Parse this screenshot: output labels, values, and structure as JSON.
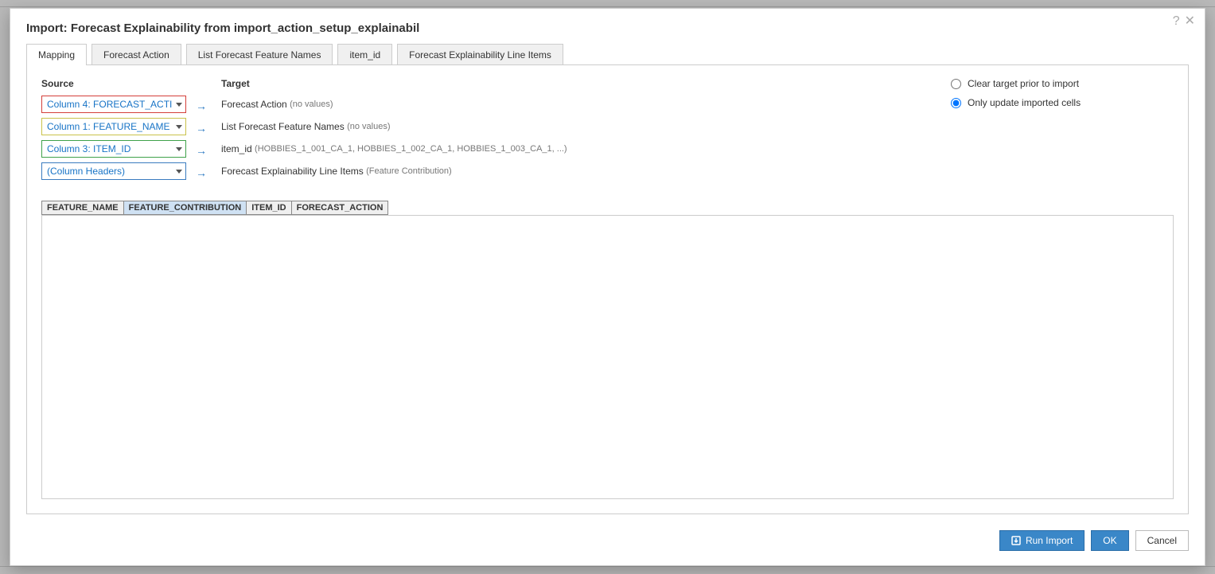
{
  "dialog": {
    "title": "Import: Forecast Explainability from import_action_setup_explainabil"
  },
  "tabs": [
    {
      "label": "Mapping",
      "active": true
    },
    {
      "label": "Forecast Action",
      "active": false
    },
    {
      "label": "List Forecast Feature Names",
      "active": false
    },
    {
      "label": "item_id",
      "active": false
    },
    {
      "label": "Forecast Explainability Line Items",
      "active": false
    }
  ],
  "mapping": {
    "source_header": "Source",
    "target_header": "Target",
    "rows": [
      {
        "source": "Column 4: FORECAST_ACTI",
        "border": "red",
        "target": "Forecast Action",
        "hint": "(no values)"
      },
      {
        "source": "Column 1: FEATURE_NAME",
        "border": "yellow",
        "target": "List Forecast Feature Names",
        "hint": "(no values)"
      },
      {
        "source": "Column 3: ITEM_ID",
        "border": "green",
        "target": "item_id",
        "hint": "(HOBBIES_1_001_CA_1, HOBBIES_1_002_CA_1, HOBBIES_1_003_CA_1, ...)"
      },
      {
        "source": "(Column Headers)",
        "border": "blue",
        "target": "Forecast Explainability Line Items",
        "hint": "(Feature Contribution)"
      }
    ]
  },
  "options": {
    "clear_label": "Clear target prior to import",
    "clear_checked": false,
    "only_update_label": "Only update imported cells",
    "only_update_checked": true
  },
  "column_tags": [
    {
      "label": "FEATURE_NAME",
      "selected": false
    },
    {
      "label": "FEATURE_CONTRIBUTION",
      "selected": true
    },
    {
      "label": "ITEM_ID",
      "selected": false
    },
    {
      "label": "FORECAST_ACTION",
      "selected": false
    }
  ],
  "footer": {
    "run_import": "Run Import",
    "ok": "OK",
    "cancel": "Cancel"
  }
}
